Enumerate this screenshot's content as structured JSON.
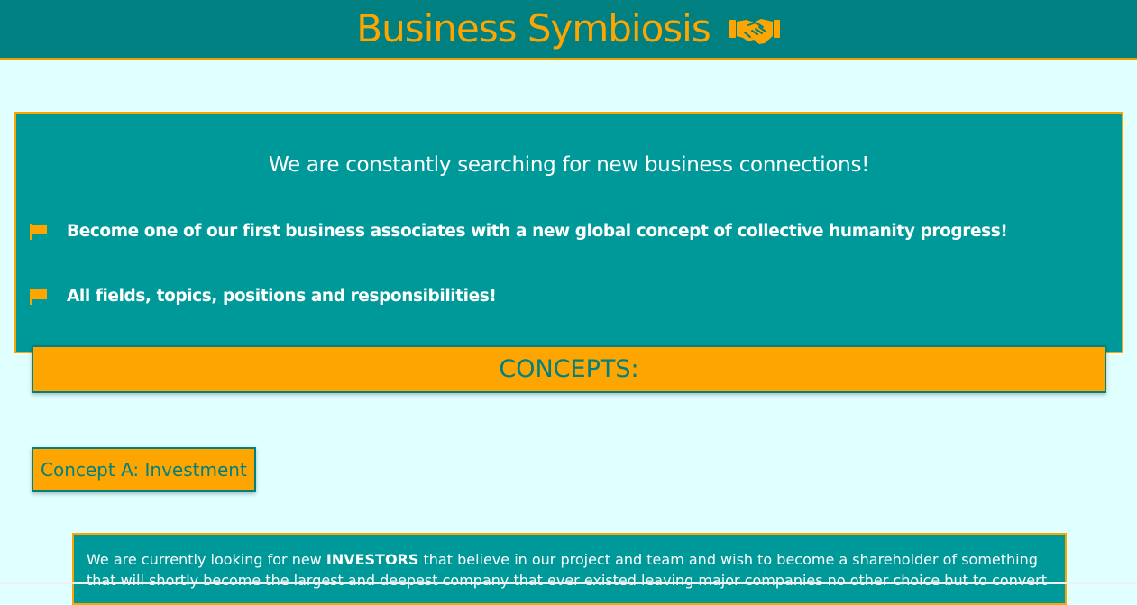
{
  "header": {
    "title": "Business Symbiosis",
    "icon": "handshake-icon",
    "title_color": "#ffa500",
    "background": "#008080"
  },
  "promo": {
    "heading": "We are constantly searching for new business connections!",
    "items": [
      {
        "icon": "flag-icon",
        "text": "Become one of our first business associates with a new global concept of collective humanity progress!"
      },
      {
        "icon": "flag-icon",
        "text": "All fields, topics, positions and responsibilities!"
      }
    ],
    "background": "#009999"
  },
  "concepts": {
    "title": "CONCEPTS:",
    "background": "#ffa500"
  },
  "concept_a": {
    "button_label": "Concept A: Investment",
    "text_before": "We are currently looking for new ",
    "text_strong": "INVESTORS",
    "text_after": " that believe in our project and team and wish to become a shareholder of something that will shortly become the largest and deepest company that ever existed leaving major companies no other choice but to convert"
  },
  "colors": {
    "page_background": "#e0ffff",
    "accent": "#ffa500",
    "teal": "#008080"
  }
}
